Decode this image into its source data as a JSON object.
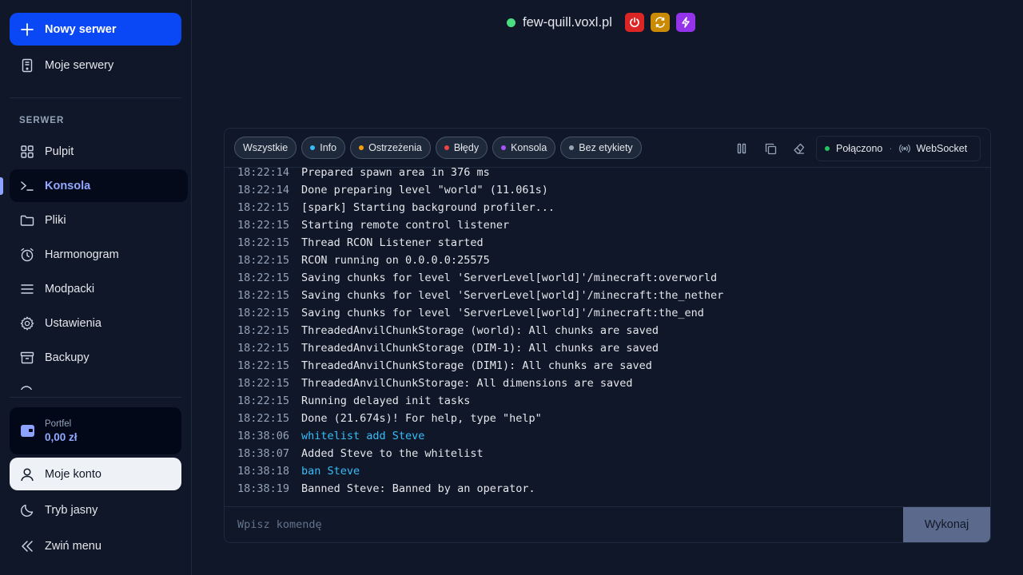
{
  "sidebar": {
    "new_server": "Nowy serwer",
    "my_servers": "Moje serwery",
    "section_label": "SERWER",
    "items": [
      {
        "label": "Pulpit"
      },
      {
        "label": "Konsola"
      },
      {
        "label": "Pliki"
      },
      {
        "label": "Harmonogram"
      },
      {
        "label": "Modpacki"
      },
      {
        "label": "Ustawienia"
      },
      {
        "label": "Backupy"
      }
    ],
    "wallet": {
      "label": "Portfel",
      "value": "0,00 zł"
    },
    "account": "Moje konto",
    "theme": "Tryb jasny",
    "collapse": "Zwiń menu"
  },
  "server": {
    "name": "few-quill.voxl.pl",
    "status_color": "#4ade80"
  },
  "console": {
    "filters": [
      {
        "label": "Wszystkie",
        "color": ""
      },
      {
        "label": "Info",
        "color": "#38bdf8"
      },
      {
        "label": "Ostrzeżenia",
        "color": "#f59e0b"
      },
      {
        "label": "Błędy",
        "color": "#ef4444"
      },
      {
        "label": "Konsola",
        "color": "#a855f7"
      },
      {
        "label": "Bez etykiety",
        "color": "#9ca3af"
      }
    ],
    "connection": {
      "status": "Połączono",
      "transport": "WebSocket"
    },
    "lines": [
      {
        "ts": "18:22:14",
        "msg": "Prepared spawn area in 376 ms",
        "cmd": false
      },
      {
        "ts": "18:22:14",
        "msg": "Done preparing level \"world\" (11.061s)",
        "cmd": false
      },
      {
        "ts": "18:22:15",
        "msg": "[spark] Starting background profiler...",
        "cmd": false
      },
      {
        "ts": "18:22:15",
        "msg": "Starting remote control listener",
        "cmd": false
      },
      {
        "ts": "18:22:15",
        "msg": "Thread RCON Listener started",
        "cmd": false
      },
      {
        "ts": "18:22:15",
        "msg": "RCON running on 0.0.0.0:25575",
        "cmd": false
      },
      {
        "ts": "18:22:15",
        "msg": "Saving chunks for level 'ServerLevel[world]'/minecraft:overworld",
        "cmd": false
      },
      {
        "ts": "18:22:15",
        "msg": "Saving chunks for level 'ServerLevel[world]'/minecraft:the_nether",
        "cmd": false
      },
      {
        "ts": "18:22:15",
        "msg": "Saving chunks for level 'ServerLevel[world]'/minecraft:the_end",
        "cmd": false
      },
      {
        "ts": "18:22:15",
        "msg": "ThreadedAnvilChunkStorage (world): All chunks are saved",
        "cmd": false
      },
      {
        "ts": "18:22:15",
        "msg": "ThreadedAnvilChunkStorage (DIM-1): All chunks are saved",
        "cmd": false
      },
      {
        "ts": "18:22:15",
        "msg": "ThreadedAnvilChunkStorage (DIM1): All chunks are saved",
        "cmd": false
      },
      {
        "ts": "18:22:15",
        "msg": "ThreadedAnvilChunkStorage: All dimensions are saved",
        "cmd": false
      },
      {
        "ts": "18:22:15",
        "msg": "Running delayed init tasks",
        "cmd": false
      },
      {
        "ts": "18:22:15",
        "msg": "Done (21.674s)! For help, type \"help\"",
        "cmd": false
      },
      {
        "ts": "18:38:06",
        "msg": "whitelist add Steve",
        "cmd": true
      },
      {
        "ts": "18:38:07",
        "msg": "Added Steve to the whitelist",
        "cmd": false
      },
      {
        "ts": "18:38:18",
        "msg": "ban Steve",
        "cmd": true
      },
      {
        "ts": "18:38:19",
        "msg": "Banned Steve: Banned by an operator.",
        "cmd": false
      }
    ],
    "input_placeholder": "Wpisz komendę",
    "execute": "Wykonaj"
  }
}
